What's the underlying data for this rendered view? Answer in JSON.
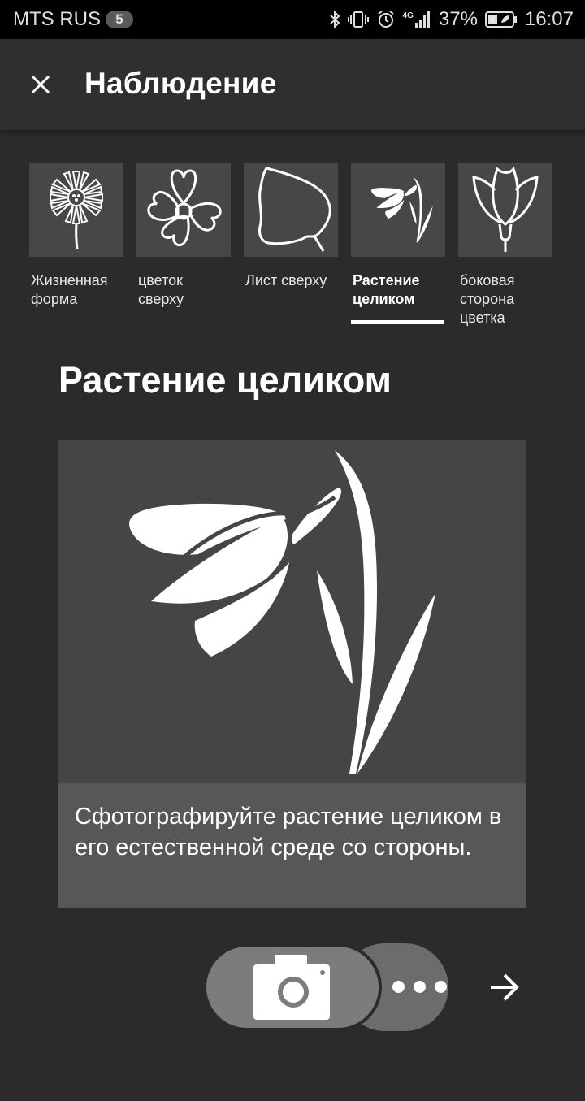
{
  "status_bar": {
    "carrier": "MTS RUS",
    "sim_badge": "5",
    "network": "4G",
    "battery": "37%",
    "time": "16:07",
    "icons": [
      "bluetooth-icon",
      "vibrate-icon",
      "alarm-icon",
      "signal-icon",
      "battery-icon"
    ]
  },
  "app_bar": {
    "title": "Наблюдение",
    "close_icon": "close-icon"
  },
  "tabs": [
    {
      "label": "Жизненная форма",
      "icon": "life-form-icon",
      "active": false
    },
    {
      "label": "цветок сверху",
      "icon": "flower-top-icon",
      "active": false
    },
    {
      "label": "Лист сверху",
      "icon": "leaf-top-icon",
      "active": false
    },
    {
      "label": "Растение целиком",
      "icon": "whole-plant-icon",
      "active": true
    },
    {
      "label": "боковая сторона цветка",
      "icon": "flower-side-icon",
      "active": false
    }
  ],
  "main": {
    "title": "Растение целиком",
    "illustration": "snowdrop-plant-illustration",
    "caption": "Сфотографируйте растение целиком в его естественной среде со стороны."
  },
  "actions": {
    "camera_icon": "camera-icon",
    "more_icon": "more-dots-icon",
    "next_icon": "arrow-right-icon"
  },
  "colors": {
    "background": "#2b2b2b",
    "app_bar": "#2f2f2f",
    "thumb": "#474747",
    "illustration_bg": "#454545",
    "caption_bg": "#575757",
    "camera_button": "#7c7c7c",
    "more_button": "#6c6c6c",
    "accent": "#ffffff"
  }
}
